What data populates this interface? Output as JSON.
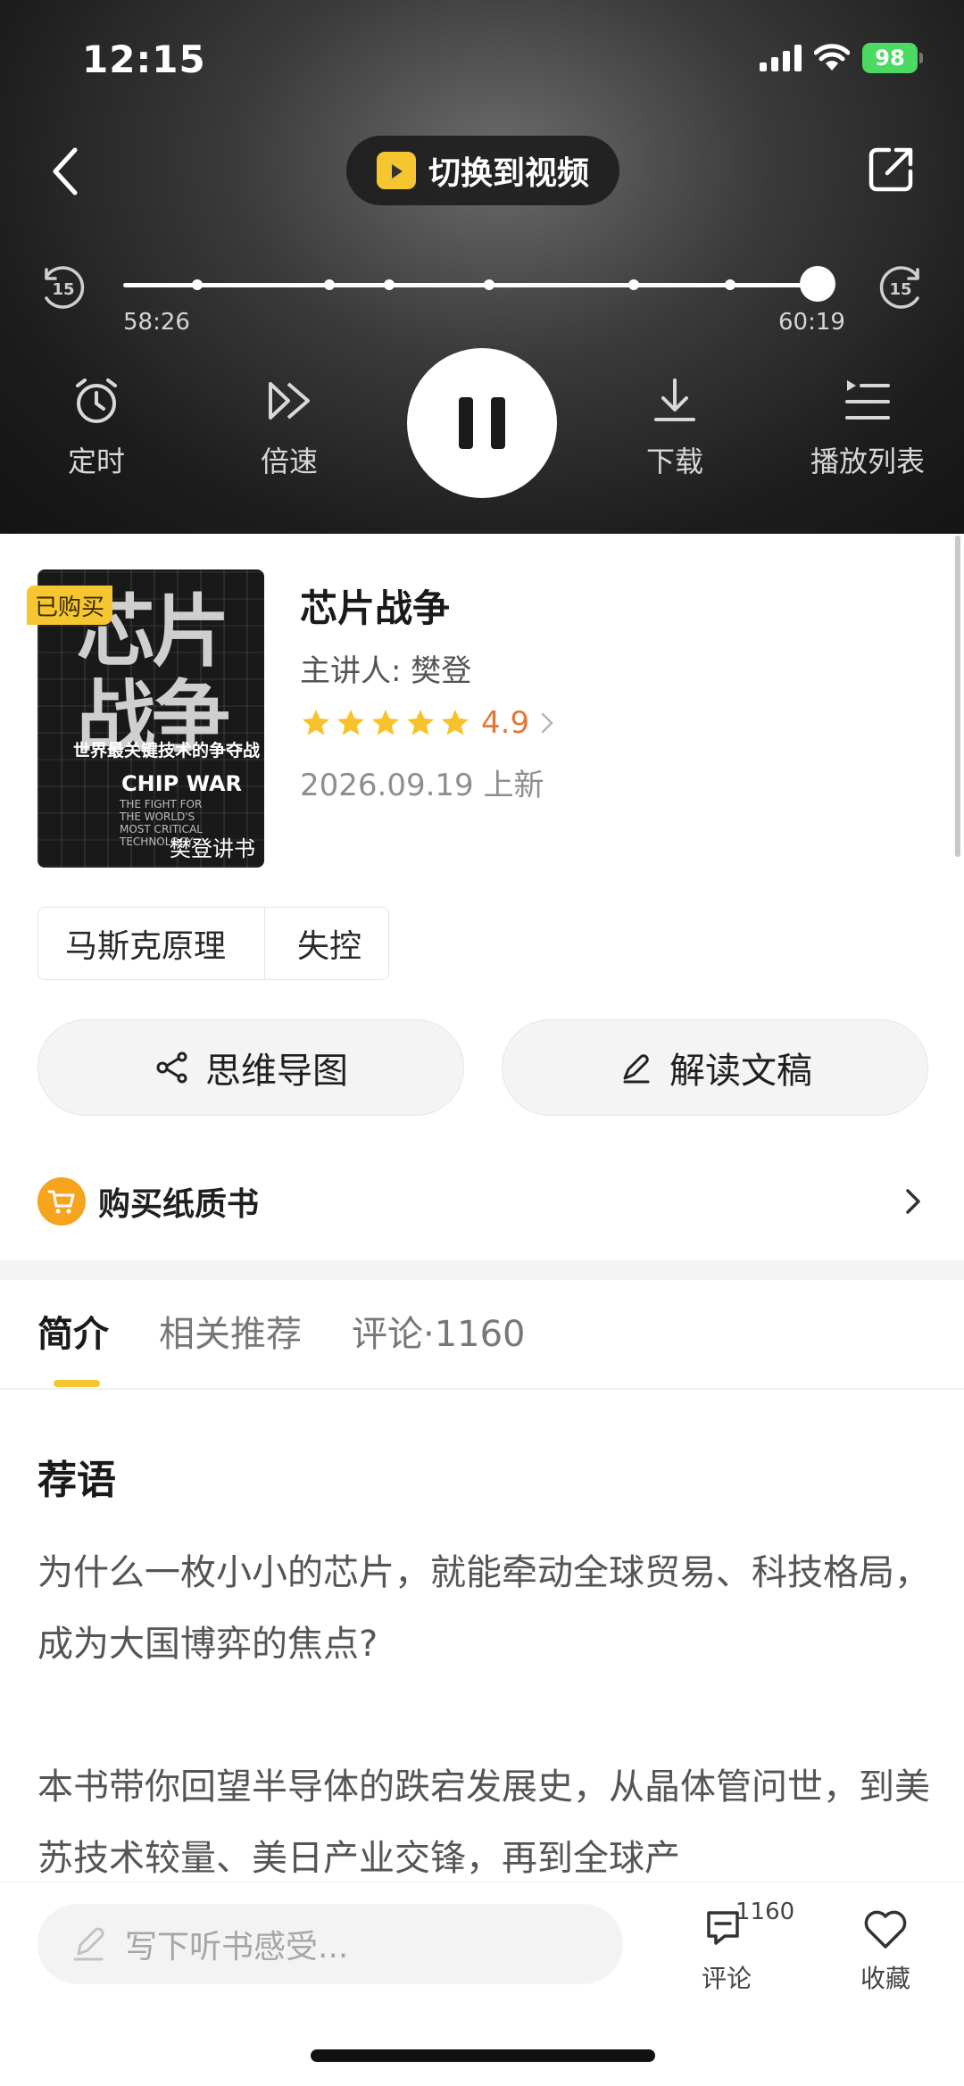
{
  "status": {
    "time": "12:15",
    "battery": "98"
  },
  "player": {
    "switch_label": "切换到视频",
    "skip_back_label": "15",
    "skip_fwd_label": "15",
    "time_current": "58:26",
    "time_total": "60:19",
    "controls": {
      "timer": "定时",
      "speed": "倍速",
      "download": "下载",
      "playlist": "播放列表"
    }
  },
  "book": {
    "title": "芯片战争",
    "speaker": "主讲人: 樊登",
    "rating": "4.9",
    "release": "2026.09.19 上新",
    "purchased_tag": "已购买",
    "cover": {
      "title": "芯片战争",
      "subtitle": "世界最关键技术的争夺战",
      "en_title": "CHIP WAR",
      "en_subtitle": "THE FIGHT FOR THE WORLD'S MOST CRITICAL TECHNOLOGY",
      "brand": "樊登讲书"
    }
  },
  "tags": [
    "马斯克原理",
    "失控"
  ],
  "actions": {
    "mind_map": "思维导图",
    "transcript": "解读文稿"
  },
  "buy": {
    "label": "购买纸质书"
  },
  "tabs": [
    "简介",
    "相关推荐",
    "评论·1160"
  ],
  "content": {
    "section_title": "荐语",
    "paragraphs": [
      "为什么一枚小小的芯片，就能牵动全球贸易、科技格局，成为大国博弈的焦点?",
      "本书带你回望半导体的跌宕发展史，从晶体管问世，到美苏技术较量、美日产业交锋，再到全球产"
    ]
  },
  "bottom_bar": {
    "input_placeholder": "写下听书感受...",
    "comments_label": "评论",
    "comments_count": "1160",
    "favorite_label": "收藏"
  },
  "colors": {
    "accent": "#f5c630",
    "rating": "#e2783a",
    "buy_icon": "#f6a31d"
  }
}
